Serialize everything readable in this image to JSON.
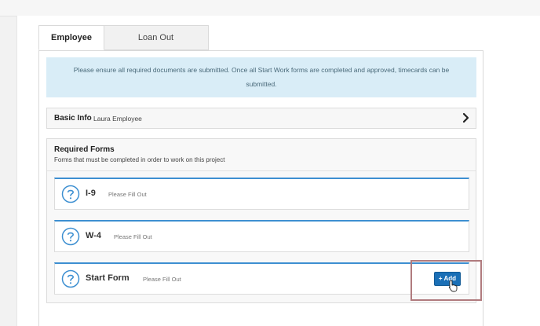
{
  "tabs": [
    {
      "label": "Employee",
      "active": true
    },
    {
      "label": "Loan Out",
      "active": false
    }
  ],
  "notice": {
    "text": "Please ensure all required documents are submitted. Once all Start Work forms are completed and approved, timecards can be submitted."
  },
  "basic_info": {
    "label": "Basic Info",
    "name": "Laura Employee",
    "chevron_icon": "chevron-right-icon"
  },
  "required_forms": {
    "title": "Required Forms",
    "subtitle": "Forms that must be completed in order to work on this project",
    "forms": [
      {
        "name": "I-9",
        "status": "Please Fill Out",
        "icon": "question-circle-icon"
      },
      {
        "name": "W-4",
        "status": "Please Fill Out",
        "icon": "question-circle-icon"
      },
      {
        "name": "Start Form",
        "status": "Please Fill Out",
        "icon": "question-circle-icon"
      }
    ],
    "add_button": {
      "label": "+ Add"
    }
  },
  "colors": {
    "accent": "#3d8fd1",
    "notice_bg": "#d9edf7",
    "button": "#1a6fb6",
    "highlight": "#b07b7e"
  }
}
